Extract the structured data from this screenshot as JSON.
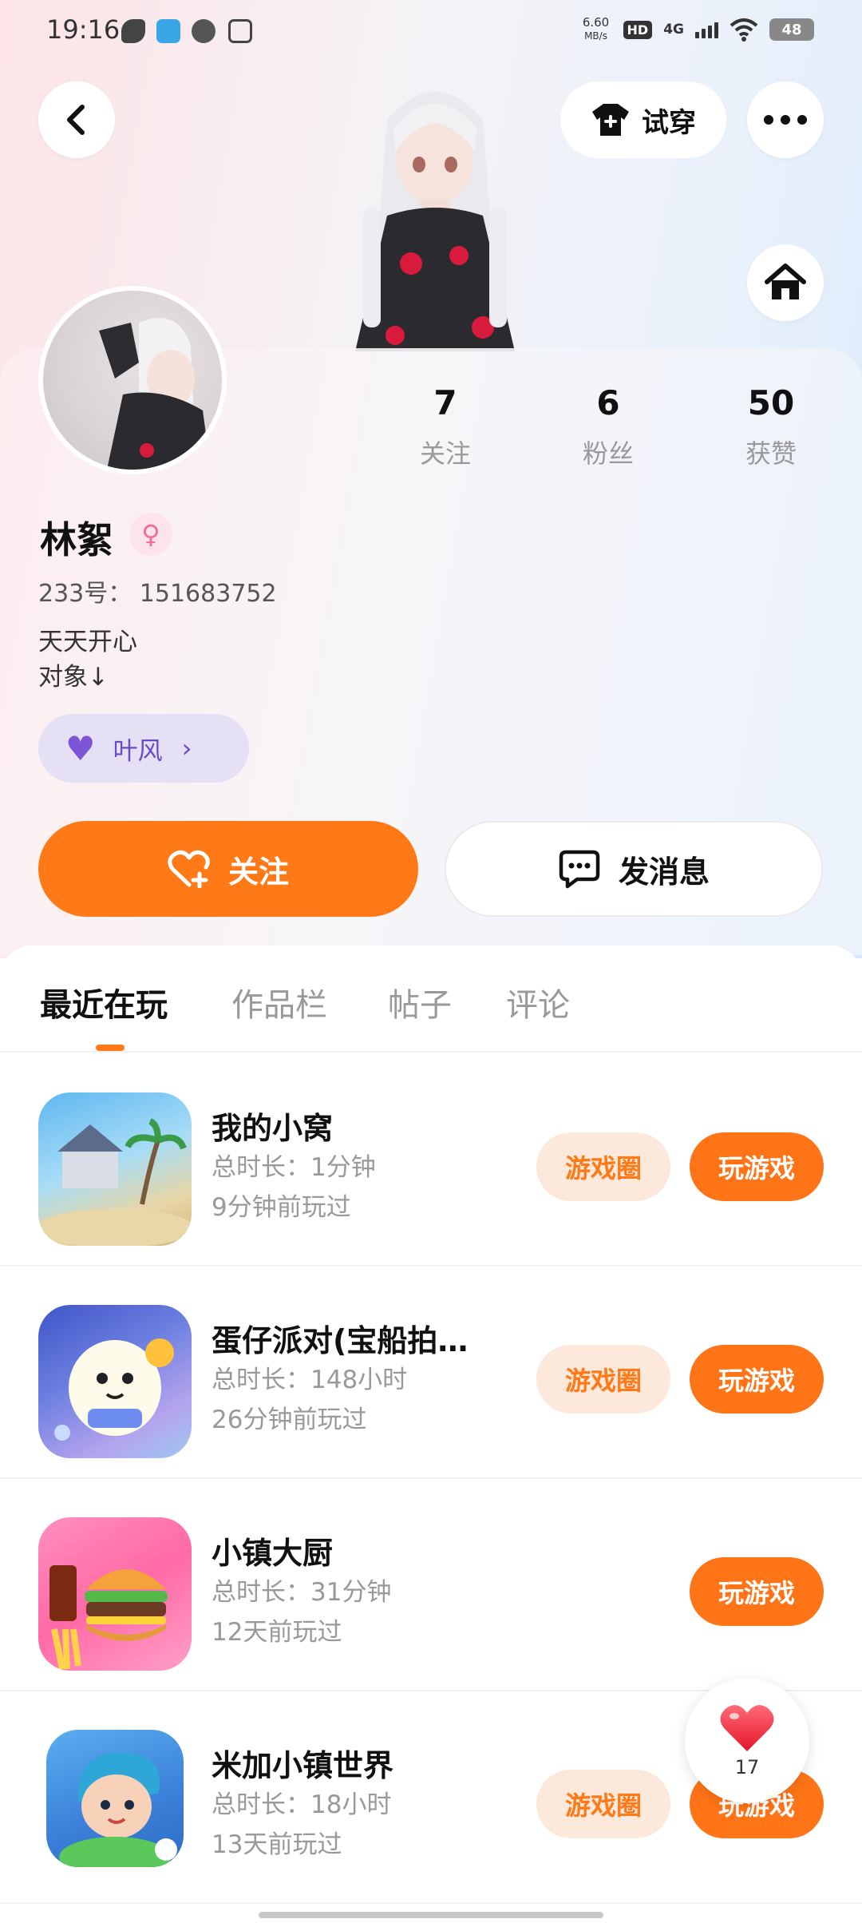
{
  "status_bar": {
    "time": "19:16",
    "net_speed_value": "6.60",
    "net_speed_unit": "MB/s",
    "hd": "HD",
    "network": "4G",
    "battery": "48"
  },
  "header": {
    "try_on_label": "试穿"
  },
  "profile": {
    "name": "林絮",
    "uid": "233号： 151683752",
    "bio_line1": "天天开心",
    "bio_line2": "对象↓",
    "partner_name": "叶风",
    "stats": [
      {
        "value": "7",
        "label": "关注"
      },
      {
        "value": "6",
        "label": "粉丝"
      },
      {
        "value": "50",
        "label": "获赞"
      }
    ]
  },
  "actions": {
    "follow_label": "关注",
    "message_label": "发消息"
  },
  "tabs": [
    "最近在玩",
    "作品栏",
    "帖子",
    "评论"
  ],
  "games": [
    {
      "title": "我的小窝",
      "duration": "总时长：1分钟",
      "last_played": "9分钟前玩过",
      "circle_label": "游戏圈",
      "play_label": "玩游戏"
    },
    {
      "title": "蛋仔派对(宝船拍…",
      "duration": "总时长：148小时",
      "last_played": "26分钟前玩过",
      "circle_label": "游戏圈",
      "play_label": "玩游戏"
    },
    {
      "title": "小镇大厨",
      "duration": "总时长：31分钟",
      "last_played": "12天前玩过",
      "circle_label": "",
      "play_label": "玩游戏"
    },
    {
      "title": "米加小镇世界",
      "duration": "总时长：18小时",
      "last_played": "13天前玩过",
      "circle_label": "游戏圈",
      "play_label": "玩游戏"
    }
  ],
  "floating_like": {
    "count": "17"
  },
  "colors": {
    "accent": "#ff7a16",
    "partner": "#6a4bc7"
  }
}
